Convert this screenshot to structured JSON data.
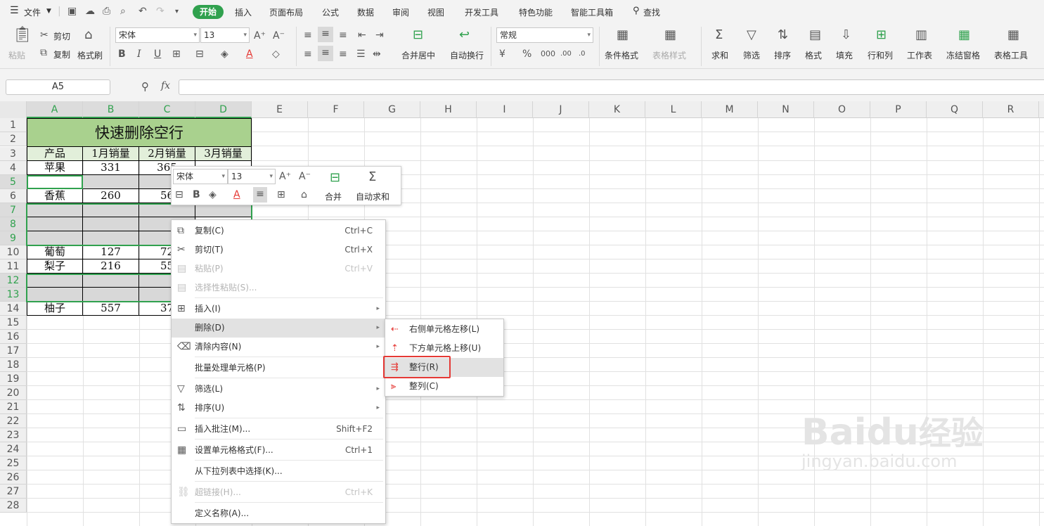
{
  "menubar": {
    "file_label": "文件",
    "tabs": [
      "开始",
      "插入",
      "页面布局",
      "公式",
      "数据",
      "审阅",
      "视图",
      "开发工具",
      "特色功能",
      "智能工具箱"
    ],
    "search_label": "查找"
  },
  "ribbon": {
    "paste": "粘贴",
    "cut": "剪切",
    "copy": "复制",
    "format_painter": "格式刷",
    "font_name": "宋体",
    "font_size": "13",
    "merge_center": "合并居中",
    "wrap_text": "自动换行",
    "number_format": "常规",
    "cond_format": "条件格式",
    "table_style": "表格样式",
    "sum": "求和",
    "filter": "筛选",
    "sort": "排序",
    "format": "格式",
    "fill": "填充",
    "row_col": "行和列",
    "worksheet": "工作表",
    "freeze": "冻结窗格",
    "table_tools": "表格工具"
  },
  "formula_bar": {
    "name_box": "A5",
    "fx": "fx",
    "value": ""
  },
  "columns": [
    "A",
    "B",
    "C",
    "D",
    "E",
    "F",
    "G",
    "H",
    "I",
    "J",
    "K",
    "L",
    "M",
    "N",
    "O",
    "P",
    "Q",
    "R"
  ],
  "rows": [
    "1",
    "2",
    "3",
    "4",
    "5",
    "6",
    "7",
    "8",
    "9",
    "10",
    "11",
    "12",
    "13",
    "14",
    "15",
    "16",
    "17",
    "18",
    "19",
    "20",
    "21",
    "22",
    "23",
    "24",
    "25",
    "26",
    "27",
    "28"
  ],
  "sheet": {
    "title": "快速删除空行",
    "headers": [
      "产品",
      "1月销量",
      "2月销量",
      "3月销量"
    ],
    "data": [
      {
        "row": "4",
        "cells": [
          "苹果",
          "331",
          "365"
        ]
      },
      {
        "row": "6",
        "cells": [
          "香蕉",
          "260",
          "56"
        ]
      },
      {
        "row": "10",
        "cells": [
          "葡萄",
          "127",
          "72"
        ]
      },
      {
        "row": "11",
        "cells": [
          "梨子",
          "216",
          "55"
        ]
      },
      {
        "row": "14",
        "cells": [
          "柚子",
          "557",
          "37"
        ]
      }
    ],
    "title_bg": "#a9d18e",
    "header_bg": "#e2efda"
  },
  "mini_toolbar": {
    "font_name": "宋体",
    "font_size": "13",
    "merge": "合并",
    "autosum": "自动求和"
  },
  "context_menu": {
    "items": [
      {
        "label": "复制(C)",
        "shortcut": "Ctrl+C",
        "icon": "copy-icon"
      },
      {
        "label": "剪切(T)",
        "shortcut": "Ctrl+X",
        "icon": "cut-icon"
      },
      {
        "label": "粘贴(P)",
        "shortcut": "Ctrl+V",
        "icon": "paste-icon",
        "disabled": true
      },
      {
        "label": "选择性粘贴(S)...",
        "shortcut": "",
        "icon": "paste-special-icon",
        "disabled": true
      },
      {
        "label": "插入(I)",
        "shortcut": "",
        "icon": "insert-icon",
        "submenu": true
      },
      {
        "label": "删除(D)",
        "shortcut": "",
        "icon": "",
        "submenu": true,
        "highlighted": true
      },
      {
        "label": "清除内容(N)",
        "shortcut": "",
        "icon": "eraser-icon",
        "submenu": true
      },
      {
        "label": "批量处理单元格(P)",
        "shortcut": "",
        "icon": ""
      },
      {
        "label": "筛选(L)",
        "shortcut": "",
        "icon": "filter-icon",
        "submenu": true
      },
      {
        "label": "排序(U)",
        "shortcut": "",
        "icon": "sort-icon",
        "submenu": true
      },
      {
        "label": "插入批注(M)...",
        "shortcut": "Shift+F2",
        "icon": "comment-icon"
      },
      {
        "label": "设置单元格格式(F)...",
        "shortcut": "Ctrl+1",
        "icon": "format-cells-icon"
      },
      {
        "label": "从下拉列表中选择(K)...",
        "shortcut": "",
        "icon": ""
      },
      {
        "label": "超链接(H)...",
        "shortcut": "Ctrl+K",
        "icon": "link-icon",
        "disabled": true
      },
      {
        "label": "定义名称(A)...",
        "shortcut": "",
        "icon": ""
      }
    ]
  },
  "submenu": {
    "items": [
      {
        "label": "右侧单元格左移(L)",
        "icon": "shift-left-icon"
      },
      {
        "label": "下方单元格上移(U)",
        "icon": "shift-up-icon"
      },
      {
        "label": "整行(R)",
        "icon": "delete-row-icon",
        "highlighted": true
      },
      {
        "label": "整列(C)",
        "icon": "delete-col-icon"
      }
    ]
  },
  "watermark": {
    "brand": "Bai",
    "brand2": "du",
    "cn": "经验",
    "url": "jingyan.baidu.com"
  }
}
